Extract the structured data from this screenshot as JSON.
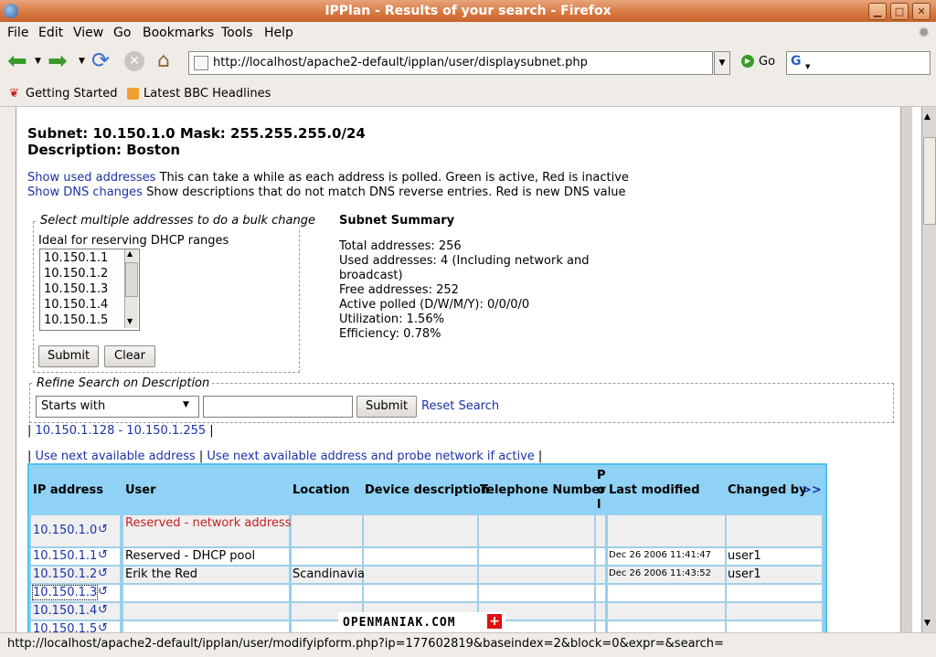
{
  "window": {
    "title": "IPPlan - Results of your search - Firefox"
  },
  "menu": [
    "File",
    "Edit",
    "View",
    "Go",
    "Bookmarks",
    "Tools",
    "Help"
  ],
  "nav": {
    "url": "http://localhost/apache2-default/ipplan/user/displaysubnet.php",
    "go_label": "Go"
  },
  "bookmarks": [
    "Getting Started",
    "Latest BBC Headlines"
  ],
  "subnet": {
    "title": "Subnet: 10.150.1.0 Mask: 255.255.255.0/24",
    "description": "Description: Boston",
    "show_used_link": "Show used addresses",
    "show_used_text": "This can take a while as each address is polled. Green is active, Red is inactive",
    "show_dns_link": "Show DNS changes",
    "show_dns_text": "Show descriptions that do not match DNS reverse entries. Red is new DNS value"
  },
  "bulk": {
    "legend": "Select multiple addresses to do a bulk change",
    "hint": "Ideal for reserving DHCP ranges",
    "options": [
      "10.150.1.1",
      "10.150.1.2",
      "10.150.1.3",
      "10.150.1.4",
      "10.150.1.5"
    ],
    "submit": "Submit",
    "clear": "Clear"
  },
  "summary": {
    "heading": "Subnet Summary",
    "lines": [
      "Total addresses: 256",
      "Used addresses: 4 (Including network and",
      "broadcast)",
      "Free addresses: 252",
      "Active polled (D/W/M/Y): 0/0/0/0",
      "Utilization: 1.56%",
      "Efficiency: 0.78%"
    ]
  },
  "refine": {
    "legend": "Refine Search on Description",
    "select_value": "Starts with",
    "input_value": "",
    "submit": "Submit",
    "reset": "Reset Search"
  },
  "range": {
    "link": "10.150.1.128 - 10.150.1.255"
  },
  "next": {
    "link1": "Use next available address",
    "link2": "Use next available address and probe network if active"
  },
  "table": {
    "headers": {
      "ip": "IP address",
      "user": "User",
      "location": "Location",
      "device": "Device description",
      "phone": "Telephone Number",
      "poll": "P o l",
      "modified": "Last modified",
      "changed": "Changed by",
      "more": ">>"
    },
    "rows": [
      {
        "ip": "10.150.1.0",
        "user": "Reserved - network address",
        "location": "",
        "modified": "",
        "changed": ""
      },
      {
        "ip": "10.150.1.1",
        "user": "Reserved - DHCP pool",
        "location": "",
        "modified": "Dec 26 2006 11:41:47",
        "changed": "user1"
      },
      {
        "ip": "10.150.1.2",
        "user": "Erik the Red",
        "location": "Scandinavia",
        "modified": "Dec 26 2006 11:43:52",
        "changed": "user1"
      },
      {
        "ip": "10.150.1.3",
        "user": "",
        "location": "",
        "modified": "",
        "changed": ""
      },
      {
        "ip": "10.150.1.4",
        "user": "",
        "location": "",
        "modified": "",
        "changed": ""
      },
      {
        "ip": "10.150.1.5",
        "user": "",
        "location": "",
        "modified": "",
        "changed": ""
      }
    ]
  },
  "watermark": "OPENMANIAK.COM",
  "status": {
    "text": "http://localhost/apache2-default/ipplan/user/modifyipform.php?ip=177602819&baseindex=2&block=0&expr=&search="
  },
  "colors": {
    "accent": "#4fc2ef",
    "link": "#1d32a6",
    "reserved": "#c62020",
    "titlebar": "#d97b44"
  }
}
